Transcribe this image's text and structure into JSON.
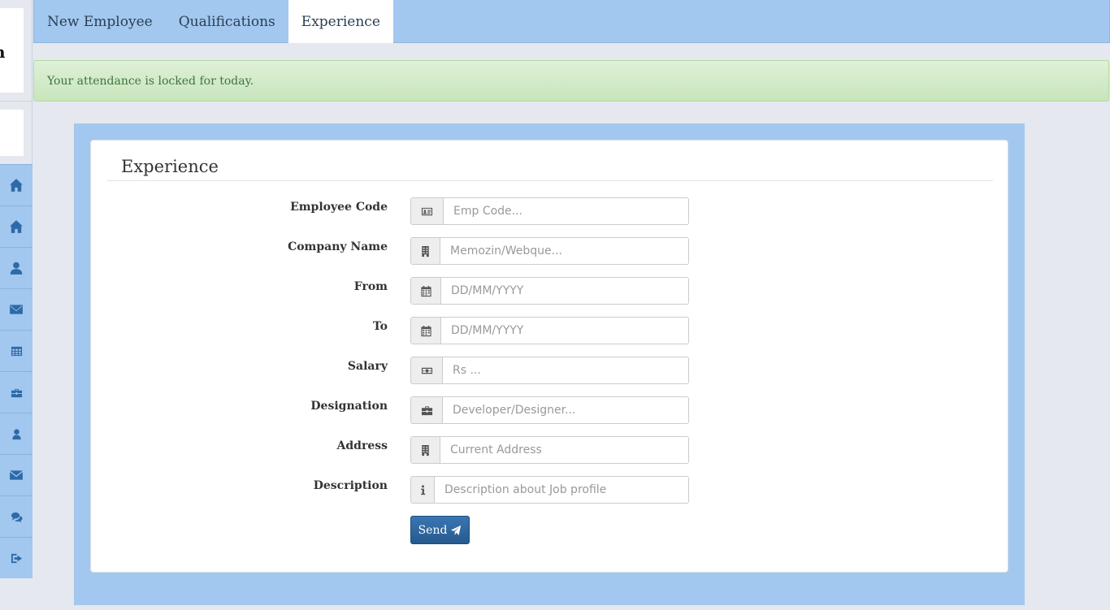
{
  "sidebar": {
    "logo_text": "n",
    "items": [
      {
        "icon": "home-icon"
      },
      {
        "icon": "home-icon"
      },
      {
        "icon": "user-icon"
      },
      {
        "icon": "envelope-icon"
      },
      {
        "icon": "table-icon"
      },
      {
        "icon": "briefcase-icon"
      },
      {
        "icon": "user-icon"
      },
      {
        "icon": "envelope-icon"
      },
      {
        "icon": "comments-icon"
      },
      {
        "icon": "sign-out-icon"
      }
    ]
  },
  "tabs": [
    {
      "label": "New Employee",
      "active": false
    },
    {
      "label": "Qualifications",
      "active": false
    },
    {
      "label": "Experience",
      "active": true
    }
  ],
  "alert": {
    "text": "Your attendance is locked for today."
  },
  "form": {
    "title": "Experience",
    "fields": [
      {
        "label": "Employee Code",
        "placeholder": "Emp Code...",
        "icon": "id-card-icon"
      },
      {
        "label": "Company Name",
        "placeholder": "Memozin/Webque...",
        "icon": "building-icon"
      },
      {
        "label": "From",
        "placeholder": "DD/MM/YYYY",
        "icon": "calendar-icon"
      },
      {
        "label": "To",
        "placeholder": "DD/MM/YYYY",
        "icon": "calendar-icon"
      },
      {
        "label": "Salary",
        "placeholder": "Rs ...",
        "icon": "money-icon"
      },
      {
        "label": "Designation",
        "placeholder": "Developer/Designer...",
        "icon": "briefcase-icon"
      },
      {
        "label": "Address",
        "placeholder": "Current Address",
        "icon": "building-icon"
      },
      {
        "label": "Description",
        "placeholder": "Description about Job profile",
        "icon": "info-icon"
      }
    ],
    "submit_label": "Send"
  },
  "colors": {
    "sidebar_bg": "#a2c8ef",
    "icon_color": "#2e6aa8",
    "alert_text": "#3c763d",
    "button_bg": "#2f6aa5"
  }
}
